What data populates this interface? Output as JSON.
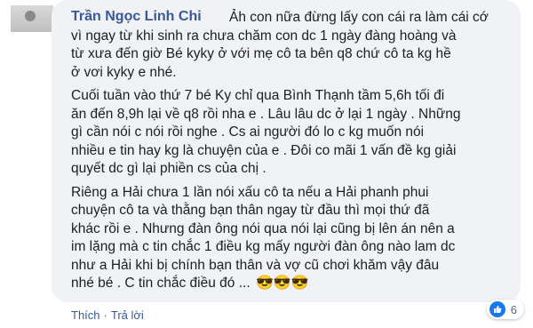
{
  "comment": {
    "author": "Trần Ngọc Linh Chi",
    "paragraphs": [
      [
        "Ảh con nữa đừng lấy con cái ra làm cái cớ",
        "vì ngay từ khi sinh ra chưa chăm con dc 1 ngày đàng hoàng và",
        "từ xưa đến giờ Bé kyky ở với mẹ cô ta bên q8 chứ cô ta kg hề",
        "ở vơi kyky e nhé."
      ],
      [
        "Cuối tuần vào thứ 7 bé Ky chỉ qua Bình Thạnh tầm 5,6h tối đi",
        "ăn đến 8,9h lại về q8 rồi nha e . Lâu lâu dc ở lại 1 ngày . Những",
        "gì cần nói c nói rồi nghe . Cs ai người đó lo c kg muốn nói",
        "nhiều e tin hay kg là chuyện của e . Đôi co mãi 1 vấn đề kg giải",
        "quyết dc gì lại phiền cs của chị ."
      ],
      [
        "Riêng a Hải chưa 1 lần nói xấu cô ta nếu a Hải phanh phui",
        "chuyện cô ta và thằng bạn thân ngay từ đầu thì mọi thứ đã",
        "khác rồi e . Nhưng đàn ông nói qua nói lại cũng bị lên án nên a",
        "im lặng mà c tin chắc 1 điều kg mấy người đàn ông nào lam dc",
        "như a Hải khi bị chính bạn thân và vợ cũ chơi khăm vậy đâu",
        "nhé bé . C tin chắc điều đó ..."
      ]
    ],
    "emoji": "😎😎😎",
    "actions": {
      "like": "Thích",
      "reply": "Trả lời"
    },
    "reactions": {
      "icon": "like-icon",
      "count": "6"
    }
  }
}
